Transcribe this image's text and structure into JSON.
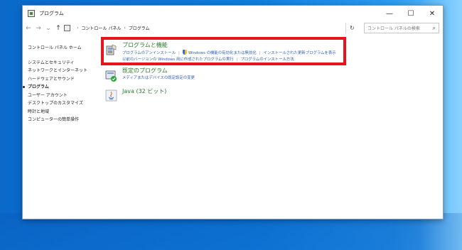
{
  "window": {
    "title": "プログラム",
    "controls": {
      "minimize": "—",
      "maximize": "☐",
      "close": "✕"
    }
  },
  "nav": {
    "back": "←",
    "forward": "→",
    "recent": "⌄",
    "up": "↑"
  },
  "address": {
    "crumbs": [
      "コントロール パネル",
      "プログラム"
    ],
    "separator": "›",
    "dropdown": "⌄",
    "refresh": "↻"
  },
  "search": {
    "placeholder": "コントロール パネルの検索",
    "icon": "⌕"
  },
  "sidebar": {
    "home": "コントロール パネル ホーム",
    "items": [
      "システムとセキュリティ",
      "ネットワークとインターネット",
      "ハードウェアとサウンド",
      "プログラム",
      "ユーザー アカウント",
      "デスクトップのカスタマイズ",
      "時計と地域",
      "コンピューターの簡単操作"
    ],
    "current_index": 3
  },
  "categories": {
    "programs_features": {
      "title": "プログラムと機能",
      "links_row1": [
        "プログラムのアンインストール",
        "Windows の機能の有効化または無効化",
        "インストールされた更新プログラムを表示"
      ],
      "links_row2": [
        "以前のバージョンの Windows 用に作成されたプログラムの実行",
        "プログラムのインストール方法"
      ]
    },
    "default_programs": {
      "title": "既定のプログラム",
      "links": [
        "メディアまたはデバイスの既定設定の変更"
      ]
    },
    "java": {
      "title": "Java (32 ビット)"
    }
  },
  "colors": {
    "highlight_box": "#e8141b",
    "category_title": "#2b7a2b",
    "link": "#2f5fb3"
  }
}
